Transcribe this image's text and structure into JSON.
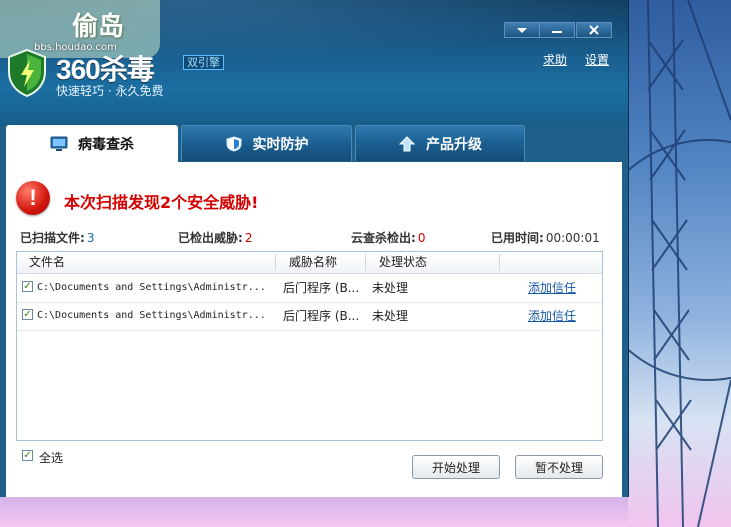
{
  "window": {
    "brand": "360杀毒",
    "badge": "双引擎",
    "tagline": "快速轻巧 · 永久免费",
    "help_link": "求助",
    "settings_link": "设置",
    "controls": [
      "dropdown-icon",
      "minimize-icon",
      "close-icon"
    ]
  },
  "watermark": {
    "title": "偷岛",
    "url": "bbs.houdao.com"
  },
  "tabs": [
    {
      "label": "病毒查杀",
      "icon": "monitor-icon",
      "active": true
    },
    {
      "label": "实时防护",
      "icon": "shield-icon",
      "active": false
    },
    {
      "label": "产品升级",
      "icon": "up-arrow-icon",
      "active": false
    }
  ],
  "alert": {
    "icon_symbol": "!",
    "message": "本次扫描发现2个安全威胁!"
  },
  "stats": {
    "scanned_label": "已扫描文件:",
    "scanned_value": "3",
    "threats_label": "已检出威胁:",
    "threats_value": "2",
    "cloud_label": "云查杀检出:",
    "cloud_value": "0",
    "time_label": "已用时间:",
    "time_value": "00:00:01"
  },
  "table": {
    "headers": [
      "文件名",
      "威胁名称",
      "处理状态"
    ],
    "rows": [
      {
        "checked": true,
        "file": "C:\\Documents and Settings\\Administr...",
        "threat": "后门程序 (B...",
        "status": "未处理",
        "action": "添加信任"
      },
      {
        "checked": true,
        "file": "C:\\Documents and Settings\\Administr...",
        "threat": "后门程序 (B...",
        "status": "未处理",
        "action": "添加信任"
      }
    ]
  },
  "footer": {
    "select_all": "全选",
    "start_button": "开始处理",
    "skip_button": "暂不处理"
  },
  "colors": {
    "title_bar": "#1a5f8f",
    "alert_red": "#d40000",
    "link_blue": "#1558a6"
  }
}
